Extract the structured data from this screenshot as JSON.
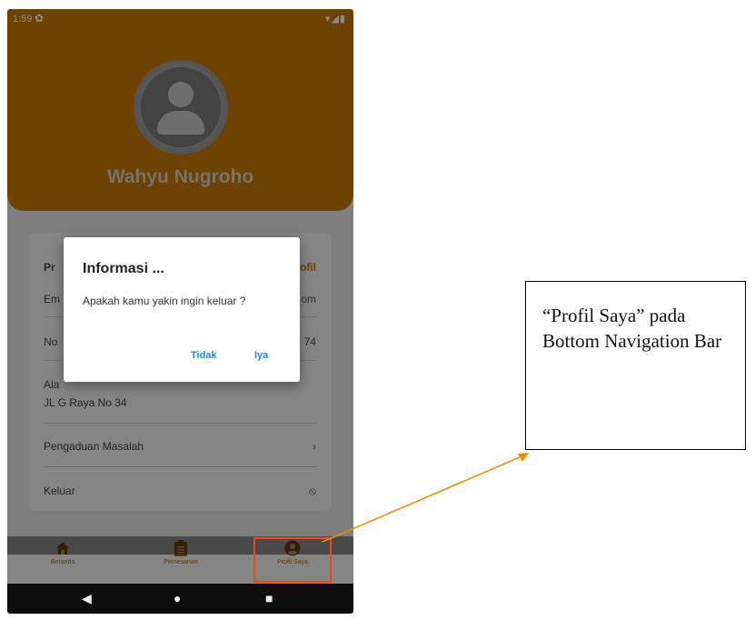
{
  "status_bar": {
    "time": "1:59",
    "gear_icon": "gear-icon",
    "indicators": "▾◢▮"
  },
  "profile": {
    "name": "Wahyu Nugroho",
    "avatar_icon": "person-icon"
  },
  "card": {
    "header_left": "Pr",
    "header_right": "ofil",
    "rows": [
      {
        "label": "Em",
        "trail": "om"
      },
      {
        "label": "No",
        "trail": "74"
      },
      {
        "label": "Ala",
        "value": "JL G Raya No 34"
      },
      {
        "label": "Pengaduan Masalah",
        "trail": "›"
      },
      {
        "label": "Keluar",
        "trail": "⦸"
      }
    ]
  },
  "dialog": {
    "title": "Informasi ...",
    "message": "Apakah kamu yakin ingin keluar ?",
    "no_label": "Tidak",
    "yes_label": "Iya"
  },
  "bottom_nav": {
    "items": [
      {
        "label": "Beranda",
        "icon": "home-icon"
      },
      {
        "label": "Pemesanan",
        "icon": "clipboard-icon"
      },
      {
        "label": "Profil Saya",
        "icon": "account-circle-icon"
      }
    ]
  },
  "android_nav": {
    "back": "◀",
    "home": "●",
    "recent": "■"
  },
  "callout": {
    "text": "“Profil Saya” pada Bottom Navigation Bar"
  },
  "colors": {
    "primary": "#c87800",
    "accent": "#1e88e5",
    "highlight": "#e64a19"
  }
}
